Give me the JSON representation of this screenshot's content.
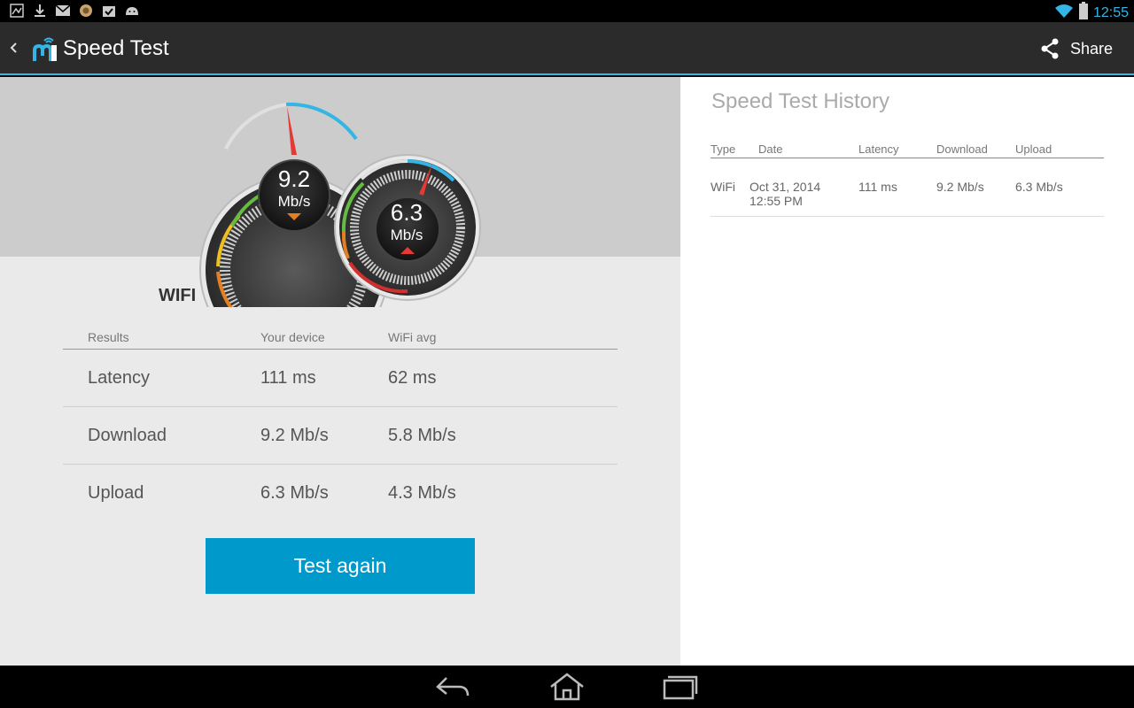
{
  "status_bar": {
    "time": "12:55",
    "icons": [
      "gallery-icon",
      "download-icon",
      "gmail-icon",
      "app-icon",
      "task-icon",
      "android-icon"
    ],
    "battery_level": 0.9
  },
  "action_bar": {
    "title": "Speed Test",
    "share_label": "Share"
  },
  "gauges": {
    "download": {
      "value": "9.2",
      "unit": "Mb/s"
    },
    "upload": {
      "value": "6.3",
      "unit": "Mb/s"
    }
  },
  "network_type": "WIFI",
  "results": {
    "headers": [
      "Results",
      "Your device",
      "WiFi avg"
    ],
    "rows": [
      [
        "Latency",
        "111 ms",
        "62 ms"
      ],
      [
        "Download",
        "9.2 Mb/s",
        "5.8 Mb/s"
      ],
      [
        "Upload",
        "6.3 Mb/s",
        "4.3 Mb/s"
      ]
    ]
  },
  "test_again_label": "Test again",
  "history": {
    "title": "Speed Test History",
    "headers": [
      "Type",
      "Date",
      "Latency",
      "Download",
      "Upload"
    ],
    "rows": [
      {
        "type": "WiFi",
        "date": "Oct 31, 2014",
        "time": "12:55 PM",
        "latency": "111 ms",
        "download": "9.2 Mb/s",
        "upload": "6.3 Mb/s"
      }
    ]
  },
  "colors": {
    "accent": "#33b5e5",
    "button": "#0099cc",
    "action_bar": "#2b2b2b"
  }
}
